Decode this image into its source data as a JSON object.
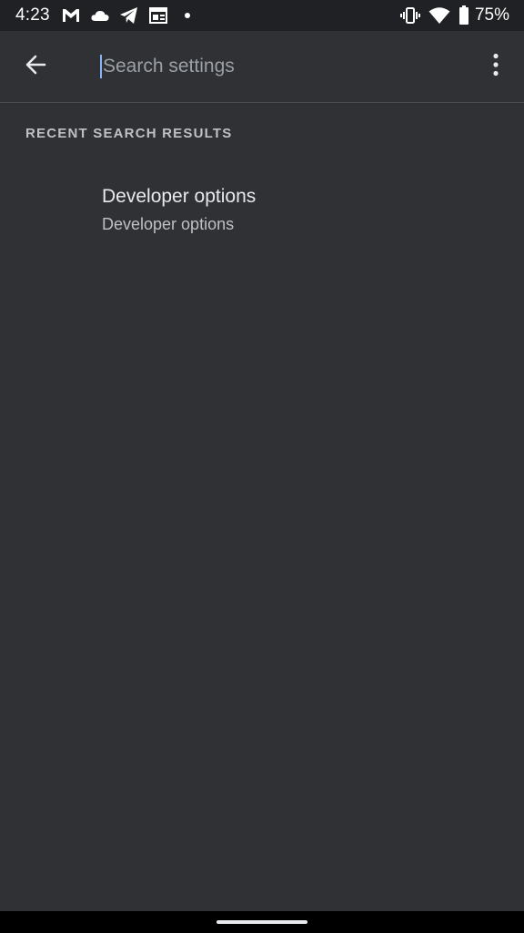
{
  "status_bar": {
    "time": "4:23",
    "left_icons": [
      "gmail-icon",
      "cloud-icon",
      "telegram-icon",
      "news-icon",
      "dot-icon"
    ],
    "right_icons": [
      "vibrate-icon",
      "wifi-icon",
      "battery-icon"
    ],
    "battery_percent": "75%"
  },
  "toolbar": {
    "search_placeholder": "Search settings",
    "search_value": ""
  },
  "recent": {
    "header": "RECENT SEARCH RESULTS",
    "items": [
      {
        "title": "Developer options",
        "subtitle": "Developer options"
      }
    ]
  },
  "colors": {
    "background": "#303134",
    "status_bar": "#202124",
    "accent_caret": "#8ab4f8"
  }
}
